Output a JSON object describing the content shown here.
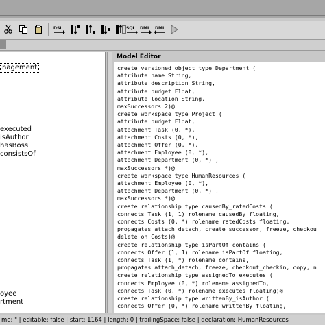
{
  "toolbar": {
    "buttons": [
      {
        "name": "cut-icon"
      },
      {
        "name": "copy-icon"
      },
      {
        "name": "paste-icon"
      },
      {
        "name": "delete-icon"
      },
      {
        "name": "dsl-button",
        "label": "DSL"
      },
      {
        "name": "generate-button-1"
      },
      {
        "name": "generate-button-2"
      },
      {
        "name": "generate-button-3"
      },
      {
        "name": "generate-button-4"
      },
      {
        "name": "sql-button",
        "label": "SQL"
      },
      {
        "name": "dml-button",
        "label": "DML"
      },
      {
        "name": "dml-button-2",
        "label": "DML"
      },
      {
        "name": "run-icon"
      }
    ]
  },
  "left_panel": {
    "items": [
      {
        "label": "nagement",
        "selected": true
      },
      {
        "label": "executed",
        "selected": false
      },
      {
        "label": "isAuthor",
        "selected": false
      },
      {
        "label": "hasBoss",
        "selected": false
      },
      {
        "label": "consistsOf",
        "selected": false
      },
      {
        "label": "oyee",
        "selected": false
      },
      {
        "label": "rtment",
        "selected": false
      }
    ]
  },
  "editor": {
    "title": "Model Editor",
    "lines": [
      "create versioned object type Department (",
      "attribute name String,",
      "attribute description String,",
      "attribute budget Float,",
      "attribute location String,",
      "maxSuccessors 2)@",
      "create workspace type Project (",
      "attribute budget Float,",
      "attachment Task (0, *),",
      "attachment Costs (0, *),",
      "attachment Offer (0, *),",
      "attachment Employee (0, *),",
      "attachment Department (0, *) ,",
      "maxSuccessors *)@",
      "create workspace type HumanResources (",
      "attachment Employee (0, *),",
      "attachment Department (0, *) ,",
      "maxSuccessors *)@",
      "create relationship type causedBy_ratedCosts (",
      "connects Task (1, 1) rolename causedBy floating,",
      "connects Costs (0, *) rolename ratedCosts floating,",
      "propagates attach_detach, create_successor, freeze, checkou",
      "delete on Costs)@",
      "create relationship type isPartOf contains (",
      "connects Offer (1, 1) rolename isPartOf floating,",
      "connects Task (1, *) rolename contains,",
      "propagates attach_detach, freeze, checkout_checkin, copy, n",
      "create relationship type assignedTo_executes (",
      "connects Employee (0, *) rolename assignedTo,",
      "connects Task (0, *) rolename executes floating)@",
      "create relationship type writtenBy_isAuthor (",
      "connects Offer (0, *) rolename writtenBy floating,"
    ]
  },
  "status": {
    "text": "me: \" | editable: false | start: 1164 | length: 0 | trailingSpace: false | declaration: HumanResources"
  }
}
